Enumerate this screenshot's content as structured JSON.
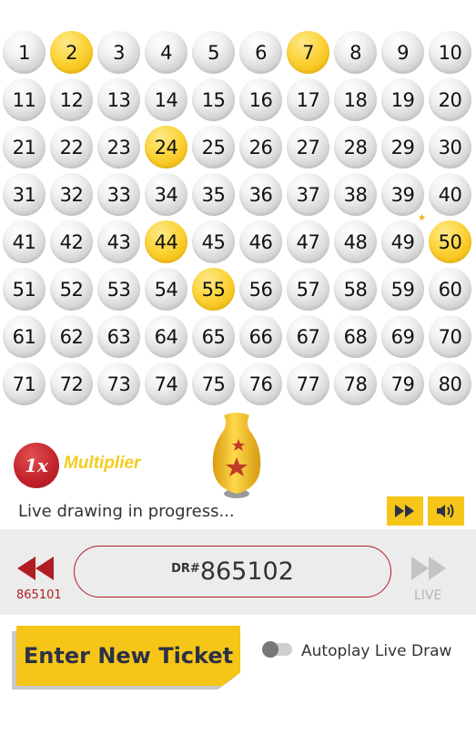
{
  "board": {
    "numbers": [
      "1",
      "2",
      "3",
      "4",
      "5",
      "6",
      "7",
      "8",
      "9",
      "10",
      "11",
      "12",
      "13",
      "14",
      "15",
      "16",
      "17",
      "18",
      "19",
      "20",
      "21",
      "22",
      "23",
      "24",
      "25",
      "26",
      "27",
      "28",
      "29",
      "30",
      "31",
      "32",
      "33",
      "34",
      "35",
      "36",
      "37",
      "38",
      "39",
      "40",
      "41",
      "42",
      "43",
      "44",
      "45",
      "46",
      "47",
      "48",
      "49",
      "50",
      "51",
      "52",
      "53",
      "54",
      "55",
      "56",
      "57",
      "58",
      "59",
      "60",
      "61",
      "62",
      "63",
      "64",
      "65",
      "66",
      "67",
      "68",
      "69",
      "70",
      "71",
      "72",
      "73",
      "74",
      "75",
      "76",
      "77",
      "78",
      "79",
      "80"
    ],
    "drawn": [
      "2",
      "7",
      "24",
      "44",
      "50",
      "55"
    ]
  },
  "multiplier": {
    "value": "1x",
    "label": "Multiplier"
  },
  "status": {
    "text": "Live drawing in progress..."
  },
  "controls": {
    "fast_forward_icon": "fast-forward-icon",
    "sound_icon": "speaker-icon"
  },
  "draw": {
    "prev_number": "865101",
    "prefix": "DR#",
    "number": "865102",
    "live_label": "LIVE"
  },
  "actions": {
    "enter_ticket": "Enter New Ticket",
    "autoplay_label": "Autoplay Live Draw",
    "autoplay_on": false
  },
  "colors": {
    "accent": "#f5c518",
    "brand_red": "#b01e24",
    "drawn_ball": "#fcd43b"
  }
}
